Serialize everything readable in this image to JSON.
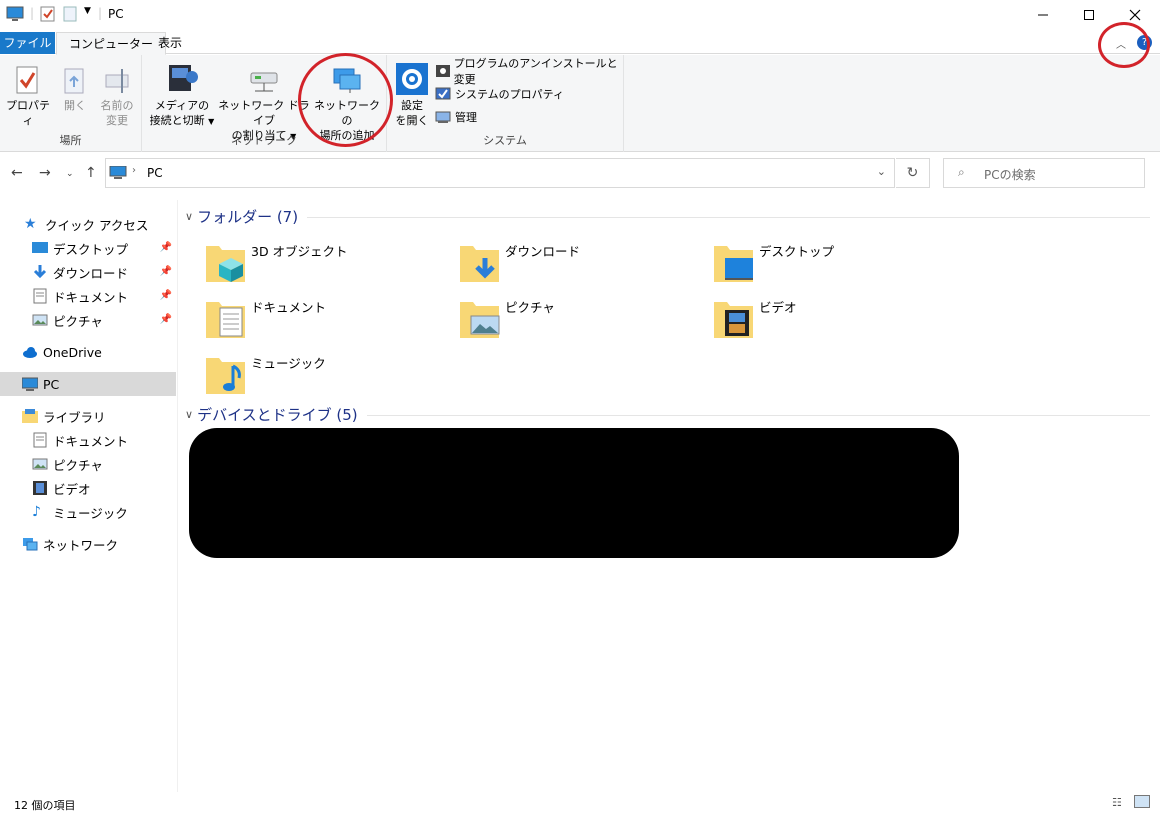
{
  "window": {
    "title": "PC"
  },
  "tabs": {
    "file": "ファイル",
    "computer": "コンピューター",
    "view": "表示"
  },
  "ribbon": {
    "location_group": {
      "label": "場所",
      "properties": "プロパティ",
      "open": "開く",
      "rename_line1": "名前の",
      "rename_line2": "変更"
    },
    "network_group": {
      "label": "ネットワーク",
      "media_line1": "メディアの",
      "media_line2": "接続と切断",
      "map_drive_line1": "ネットワーク ドライブ",
      "map_drive_line2": "の割り当て",
      "add_location_line1": "ネットワークの",
      "add_location_line2": "場所の追加"
    },
    "system_group": {
      "label": "システム",
      "settings_line1": "設定",
      "settings_line2": "を開く",
      "uninstall": "プログラムのアンインストールと変更",
      "system_properties": "システムのプロパティ",
      "manage": "管理"
    }
  },
  "address": {
    "path": "PC",
    "search_placeholder": "PCの検索"
  },
  "navpane": {
    "quick_access": "クイック アクセス",
    "quick_items": [
      "デスクトップ",
      "ダウンロード",
      "ドキュメント",
      "ピクチャ"
    ],
    "onedrive": "OneDrive",
    "pc": "PC",
    "libraries": "ライブラリ",
    "library_items": [
      "ドキュメント",
      "ピクチャ",
      "ビデオ",
      "ミュージック"
    ],
    "network": "ネットワーク"
  },
  "content": {
    "folders_header": "フォルダー (7)",
    "folders": [
      "3D オブジェクト",
      "ダウンロード",
      "デスクトップ",
      "ドキュメント",
      "ピクチャ",
      "ビデオ",
      "ミュージック"
    ],
    "devices_header": "デバイスとドライブ (5)"
  },
  "status": {
    "item_count": "12 個の項目"
  },
  "colors": {
    "accent": "#1979ca",
    "highlight_circle": "#d2232a",
    "group_header": "#1e3287",
    "folder_yellow": "#f8d775"
  }
}
